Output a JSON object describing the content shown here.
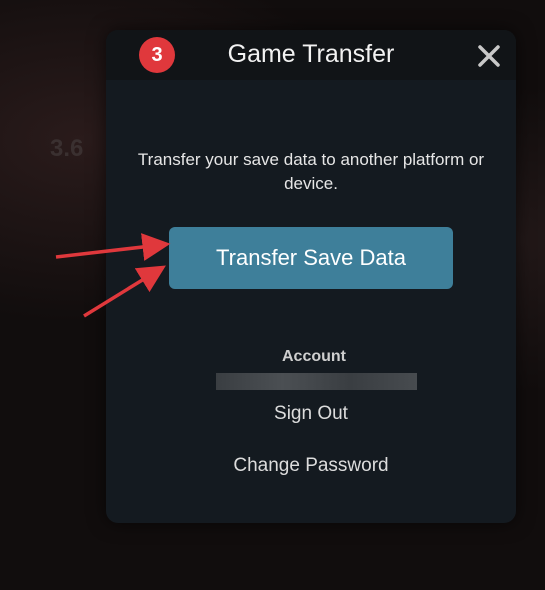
{
  "background": {
    "stat_text": "3.6"
  },
  "modal": {
    "step_badge": "3",
    "title": "Game Transfer",
    "close_icon": "close-icon",
    "description": "Transfer your save data to another platform or device.",
    "transfer_button_label": "Transfer Save Data",
    "account": {
      "label": "Account",
      "value_redacted": true
    },
    "sign_out_label": "Sign Out",
    "change_password_label": "Change Password"
  },
  "annotations": {
    "arrow_color": "#e0383c",
    "arrow_count": 2
  },
  "colors": {
    "modal_bg": "#141a20",
    "header_bg": "#111417",
    "button_bg": "#3e7f9a",
    "badge_bg": "#e0383c"
  }
}
